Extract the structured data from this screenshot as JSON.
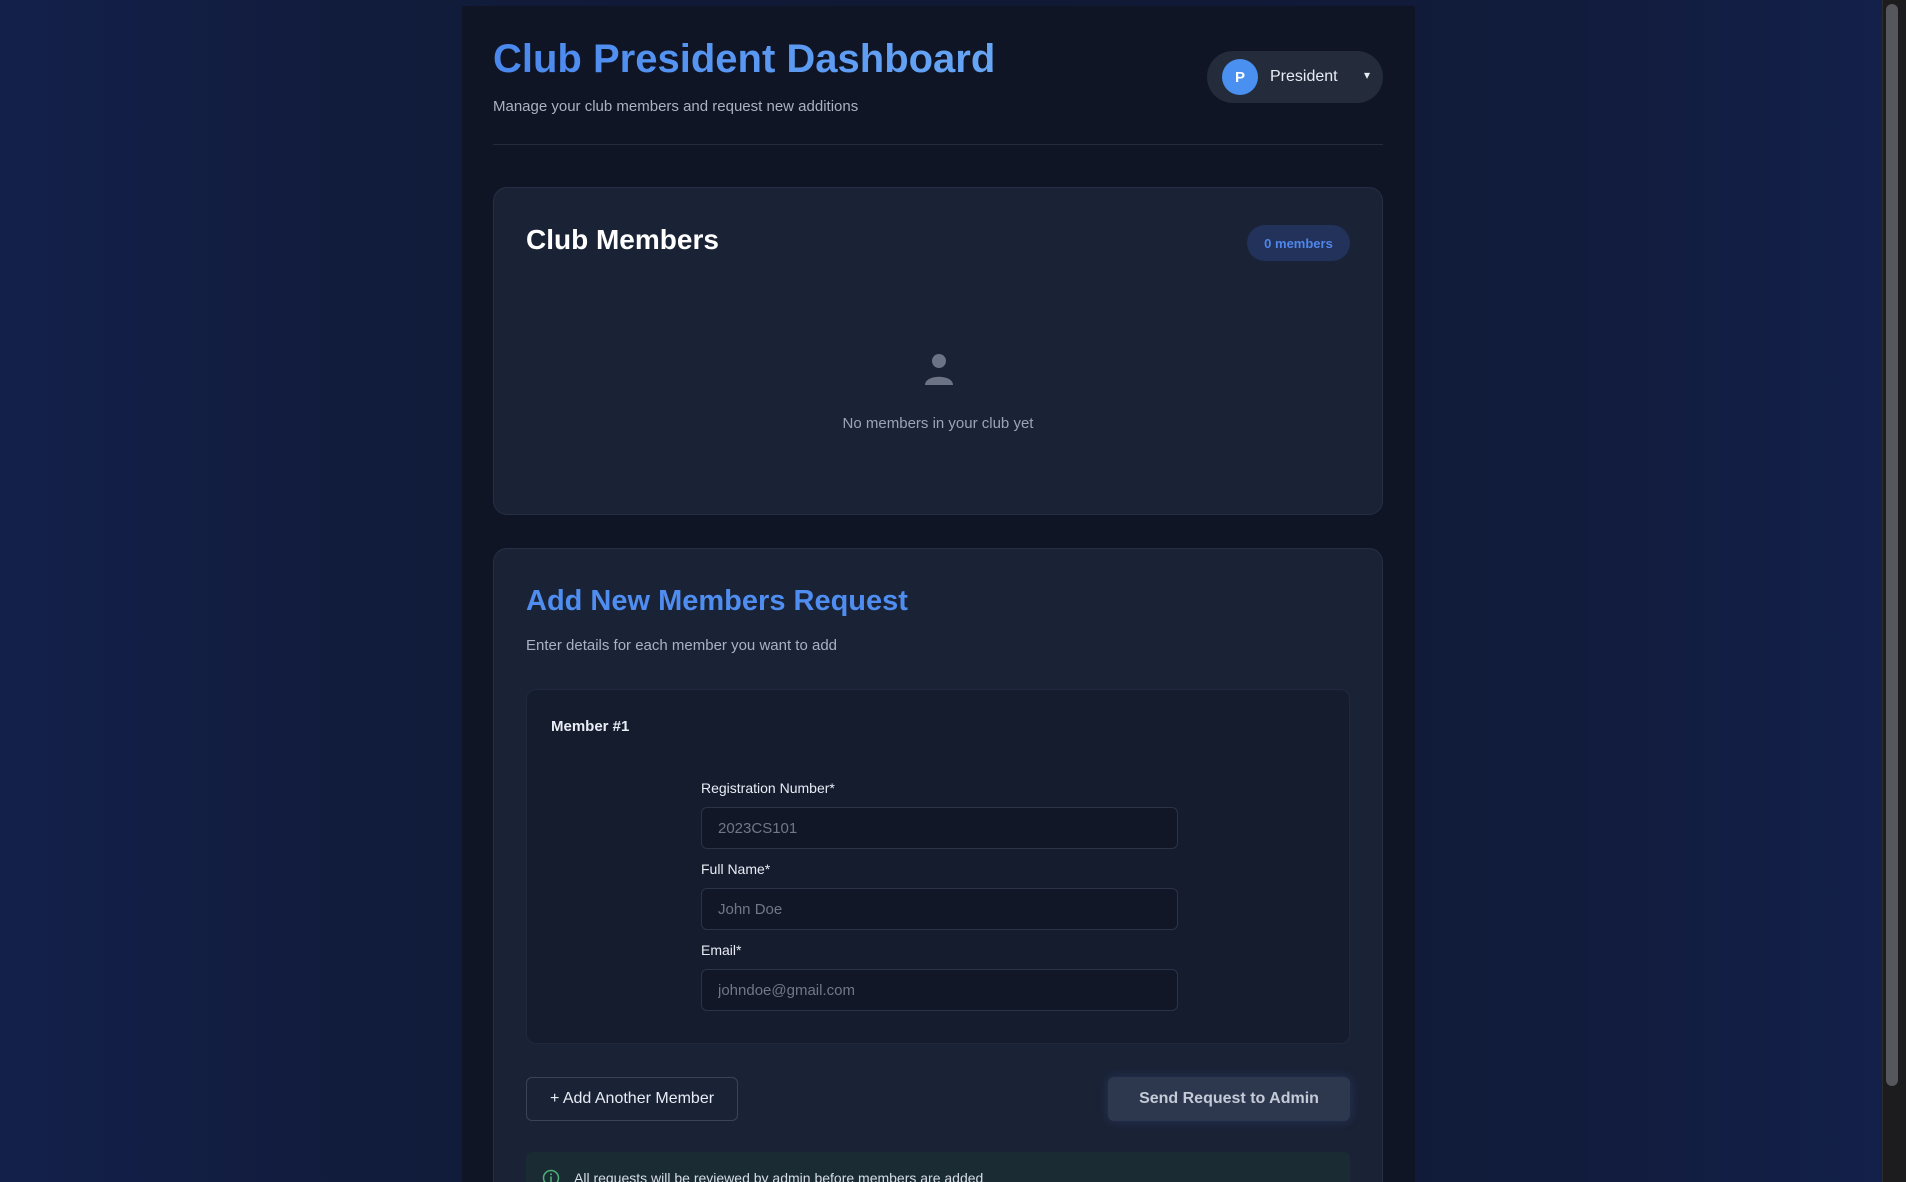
{
  "header": {
    "title": "Club President Dashboard",
    "subtitle": "Manage your club members and request new additions",
    "user": {
      "avatar_initial": "P",
      "role": "President",
      "dropdown_arrow": "▾",
      "avatar_color": "#4a90f0"
    }
  },
  "members": {
    "title": "Club Members",
    "count_label": "0 members",
    "empty_icon": "person-icon",
    "empty_text": "No members in your club yet"
  },
  "request": {
    "title": "Add New Members Request",
    "subtitle": "Enter details for each member you want to add",
    "members": [
      {
        "heading": "Member #1",
        "fields": {
          "registration": {
            "label": "Registration Number*",
            "value": "",
            "placeholder": "2023CS101"
          },
          "full_name": {
            "label": "Full Name*",
            "value": "",
            "placeholder": "John Doe"
          },
          "email": {
            "label": "Email*",
            "value": "",
            "placeholder": "johndoe@gmail.com"
          }
        }
      }
    ],
    "add_button_label": "+ Add Another Member",
    "send_button_label": "Send Request to Admin",
    "info_icon": "info-circle-icon",
    "info_text": "All requests will be reviewed by admin before members are added"
  },
  "colors": {
    "accent": "#4f8ef0",
    "background": "#0f1525",
    "card": "#1a2236",
    "info_accent": "#4caf7a"
  }
}
